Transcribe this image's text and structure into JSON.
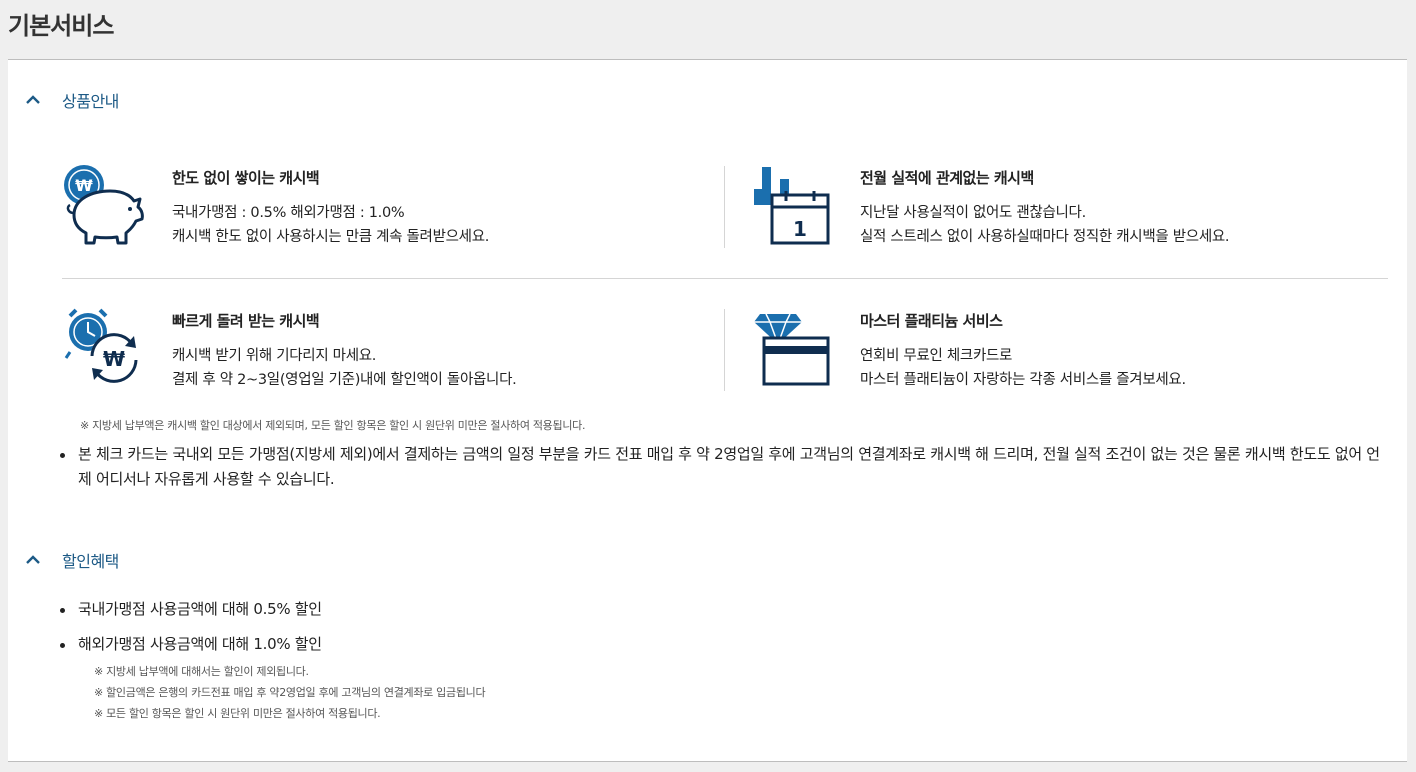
{
  "page": {
    "title": "기본서비스"
  },
  "sections": [
    {
      "title": "상품안내",
      "features": [
        {
          "icon": "piggy-bank-won-icon",
          "title": "한도 없이 쌓이는 캐시백",
          "line1": "국내가맹점 : 0.5% 해외가맹점 : 1.0%",
          "line2": "캐시백 한도 없이 사용하시는 만큼 계속 돌려받으세요."
        },
        {
          "icon": "calendar-chart-icon",
          "title": "전월 실적에 관계없는 캐시백",
          "line1": "지난달 사용실적이 없어도 괜찮습니다.",
          "line2": "실적 스트레스 없이 사용하실때마다 정직한 캐시백을 받으세요.",
          "calendar_day": "1"
        },
        {
          "icon": "alarm-clock-refresh-won-icon",
          "title": "빠르게 돌려 받는 캐시백",
          "line1": "캐시백 받기 위해 기다리지 마세요.",
          "line2": "결제 후 약 2~3일(영업일 기준)내에 할인액이 돌아옵니다."
        },
        {
          "icon": "diamond-card-icon",
          "title": "마스터 플래티늄 서비스",
          "line1": "연회비 무료인 체크카드로",
          "line2": "마스터 플래티늄이 자랑하는 각종 서비스를 즐겨보세요."
        }
      ],
      "note": "※  지방세 납부액은 캐시백 할인 대상에서 제외되며, 모든 할인 항목은 할인 시 원단위 미만은 절사하여 적용됩니다.",
      "bullet": "본 체크 카드는 국내외 모든 가맹점(지방세 제외)에서 결제하는 금액의 일정 부분을 카드 전표 매입 후 약 2영업일 후에 고객님의 연결계좌로 캐시백 해 드리며, 전월 실적 조건이 없는 것은 물론 캐시백 한도도 없어 언제 어디서나 자유롭게 사용할 수 있습니다."
    },
    {
      "title": "할인혜택",
      "bullets": [
        "국내가맹점 사용금액에 대해 0.5% 할인",
        "해외가맹점 사용금액에 대해 1.0% 할인"
      ],
      "notes": [
        "※  지방세 납부액에 대해서는 할인이 제외됩니다.",
        "※  할인금액은 은행의 카드전표 매입 후 약2영업일 후에 고객님의 연결계좌로 입금됩니다",
        "※  모든 할인 항목은 할인 시 원단위 미만은 절사하여 적용됩니다."
      ]
    }
  ],
  "icon_names": {
    "collapse": "chevron-up-icon"
  },
  "colors": {
    "icon_blue": "#1b6fae",
    "icon_navy": "#0f2d4f",
    "accent_text": "#1d5a86"
  }
}
